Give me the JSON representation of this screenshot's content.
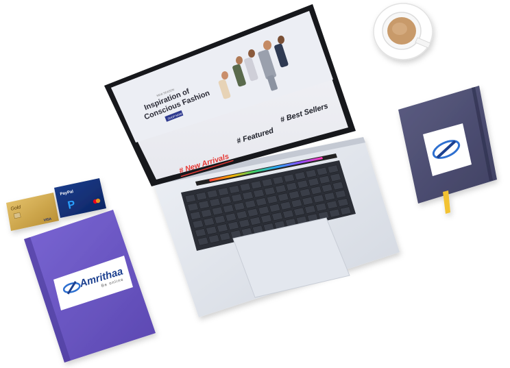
{
  "laptop_screen": {
    "tagline": "NEW SEASON",
    "headline_line1": "Inspiration of",
    "headline_line2": "Conscious Fashion",
    "cta_label": "SHOP NOW",
    "tabs": [
      {
        "label": "# New Arrivals",
        "active": true
      },
      {
        "label": "# Featured",
        "active": false
      },
      {
        "label": "# Best Sellers",
        "active": false
      }
    ],
    "accent_color": "#e53935"
  },
  "book_left": {
    "brand_name": "Amrithaa",
    "brand_tagline": "Be online",
    "cover_color": "#6a56c2"
  },
  "notebook_right": {
    "cover_color": "#4e4f73",
    "ribbon_color": "#f2c230"
  },
  "cards": {
    "gold_card": {
      "brand": "Gold",
      "network": "VISA",
      "holder": "HOLDER NAME"
    },
    "paypal_card": {
      "brand": "PayPal",
      "network": "mastercard"
    }
  },
  "coffee_cup": {
    "icon": "coffee-cup-icon"
  }
}
